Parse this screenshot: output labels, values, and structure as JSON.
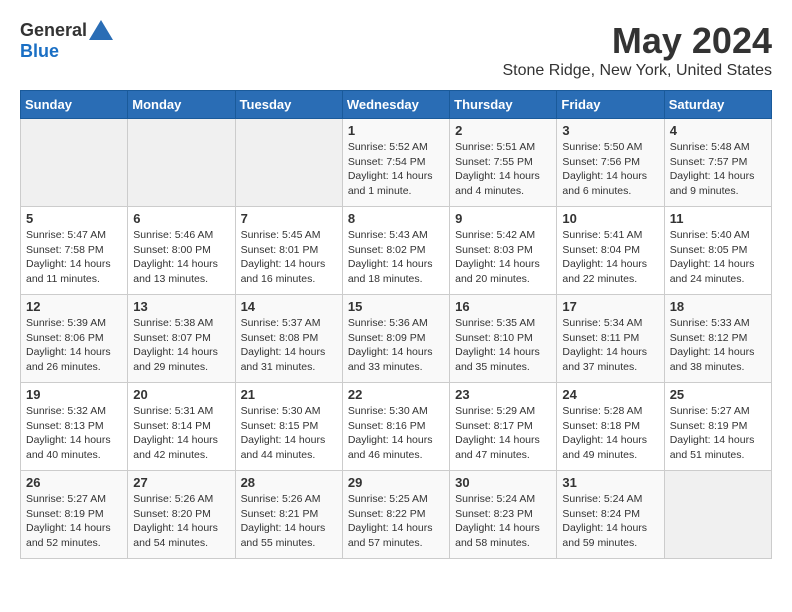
{
  "header": {
    "logo_general": "General",
    "logo_blue": "Blue",
    "month_title": "May 2024",
    "location": "Stone Ridge, New York, United States"
  },
  "days_of_week": [
    "Sunday",
    "Monday",
    "Tuesday",
    "Wednesday",
    "Thursday",
    "Friday",
    "Saturday"
  ],
  "weeks": [
    [
      {
        "day": "",
        "content": ""
      },
      {
        "day": "",
        "content": ""
      },
      {
        "day": "",
        "content": ""
      },
      {
        "day": "1",
        "content": "Sunrise: 5:52 AM\nSunset: 7:54 PM\nDaylight: 14 hours\nand 1 minute."
      },
      {
        "day": "2",
        "content": "Sunrise: 5:51 AM\nSunset: 7:55 PM\nDaylight: 14 hours\nand 4 minutes."
      },
      {
        "day": "3",
        "content": "Sunrise: 5:50 AM\nSunset: 7:56 PM\nDaylight: 14 hours\nand 6 minutes."
      },
      {
        "day": "4",
        "content": "Sunrise: 5:48 AM\nSunset: 7:57 PM\nDaylight: 14 hours\nand 9 minutes."
      }
    ],
    [
      {
        "day": "5",
        "content": "Sunrise: 5:47 AM\nSunset: 7:58 PM\nDaylight: 14 hours\nand 11 minutes."
      },
      {
        "day": "6",
        "content": "Sunrise: 5:46 AM\nSunset: 8:00 PM\nDaylight: 14 hours\nand 13 minutes."
      },
      {
        "day": "7",
        "content": "Sunrise: 5:45 AM\nSunset: 8:01 PM\nDaylight: 14 hours\nand 16 minutes."
      },
      {
        "day": "8",
        "content": "Sunrise: 5:43 AM\nSunset: 8:02 PM\nDaylight: 14 hours\nand 18 minutes."
      },
      {
        "day": "9",
        "content": "Sunrise: 5:42 AM\nSunset: 8:03 PM\nDaylight: 14 hours\nand 20 minutes."
      },
      {
        "day": "10",
        "content": "Sunrise: 5:41 AM\nSunset: 8:04 PM\nDaylight: 14 hours\nand 22 minutes."
      },
      {
        "day": "11",
        "content": "Sunrise: 5:40 AM\nSunset: 8:05 PM\nDaylight: 14 hours\nand 24 minutes."
      }
    ],
    [
      {
        "day": "12",
        "content": "Sunrise: 5:39 AM\nSunset: 8:06 PM\nDaylight: 14 hours\nand 26 minutes."
      },
      {
        "day": "13",
        "content": "Sunrise: 5:38 AM\nSunset: 8:07 PM\nDaylight: 14 hours\nand 29 minutes."
      },
      {
        "day": "14",
        "content": "Sunrise: 5:37 AM\nSunset: 8:08 PM\nDaylight: 14 hours\nand 31 minutes."
      },
      {
        "day": "15",
        "content": "Sunrise: 5:36 AM\nSunset: 8:09 PM\nDaylight: 14 hours\nand 33 minutes."
      },
      {
        "day": "16",
        "content": "Sunrise: 5:35 AM\nSunset: 8:10 PM\nDaylight: 14 hours\nand 35 minutes."
      },
      {
        "day": "17",
        "content": "Sunrise: 5:34 AM\nSunset: 8:11 PM\nDaylight: 14 hours\nand 37 minutes."
      },
      {
        "day": "18",
        "content": "Sunrise: 5:33 AM\nSunset: 8:12 PM\nDaylight: 14 hours\nand 38 minutes."
      }
    ],
    [
      {
        "day": "19",
        "content": "Sunrise: 5:32 AM\nSunset: 8:13 PM\nDaylight: 14 hours\nand 40 minutes."
      },
      {
        "day": "20",
        "content": "Sunrise: 5:31 AM\nSunset: 8:14 PM\nDaylight: 14 hours\nand 42 minutes."
      },
      {
        "day": "21",
        "content": "Sunrise: 5:30 AM\nSunset: 8:15 PM\nDaylight: 14 hours\nand 44 minutes."
      },
      {
        "day": "22",
        "content": "Sunrise: 5:30 AM\nSunset: 8:16 PM\nDaylight: 14 hours\nand 46 minutes."
      },
      {
        "day": "23",
        "content": "Sunrise: 5:29 AM\nSunset: 8:17 PM\nDaylight: 14 hours\nand 47 minutes."
      },
      {
        "day": "24",
        "content": "Sunrise: 5:28 AM\nSunset: 8:18 PM\nDaylight: 14 hours\nand 49 minutes."
      },
      {
        "day": "25",
        "content": "Sunrise: 5:27 AM\nSunset: 8:19 PM\nDaylight: 14 hours\nand 51 minutes."
      }
    ],
    [
      {
        "day": "26",
        "content": "Sunrise: 5:27 AM\nSunset: 8:19 PM\nDaylight: 14 hours\nand 52 minutes."
      },
      {
        "day": "27",
        "content": "Sunrise: 5:26 AM\nSunset: 8:20 PM\nDaylight: 14 hours\nand 54 minutes."
      },
      {
        "day": "28",
        "content": "Sunrise: 5:26 AM\nSunset: 8:21 PM\nDaylight: 14 hours\nand 55 minutes."
      },
      {
        "day": "29",
        "content": "Sunrise: 5:25 AM\nSunset: 8:22 PM\nDaylight: 14 hours\nand 57 minutes."
      },
      {
        "day": "30",
        "content": "Sunrise: 5:24 AM\nSunset: 8:23 PM\nDaylight: 14 hours\nand 58 minutes."
      },
      {
        "day": "31",
        "content": "Sunrise: 5:24 AM\nSunset: 8:24 PM\nDaylight: 14 hours\nand 59 minutes."
      },
      {
        "day": "",
        "content": ""
      }
    ]
  ]
}
